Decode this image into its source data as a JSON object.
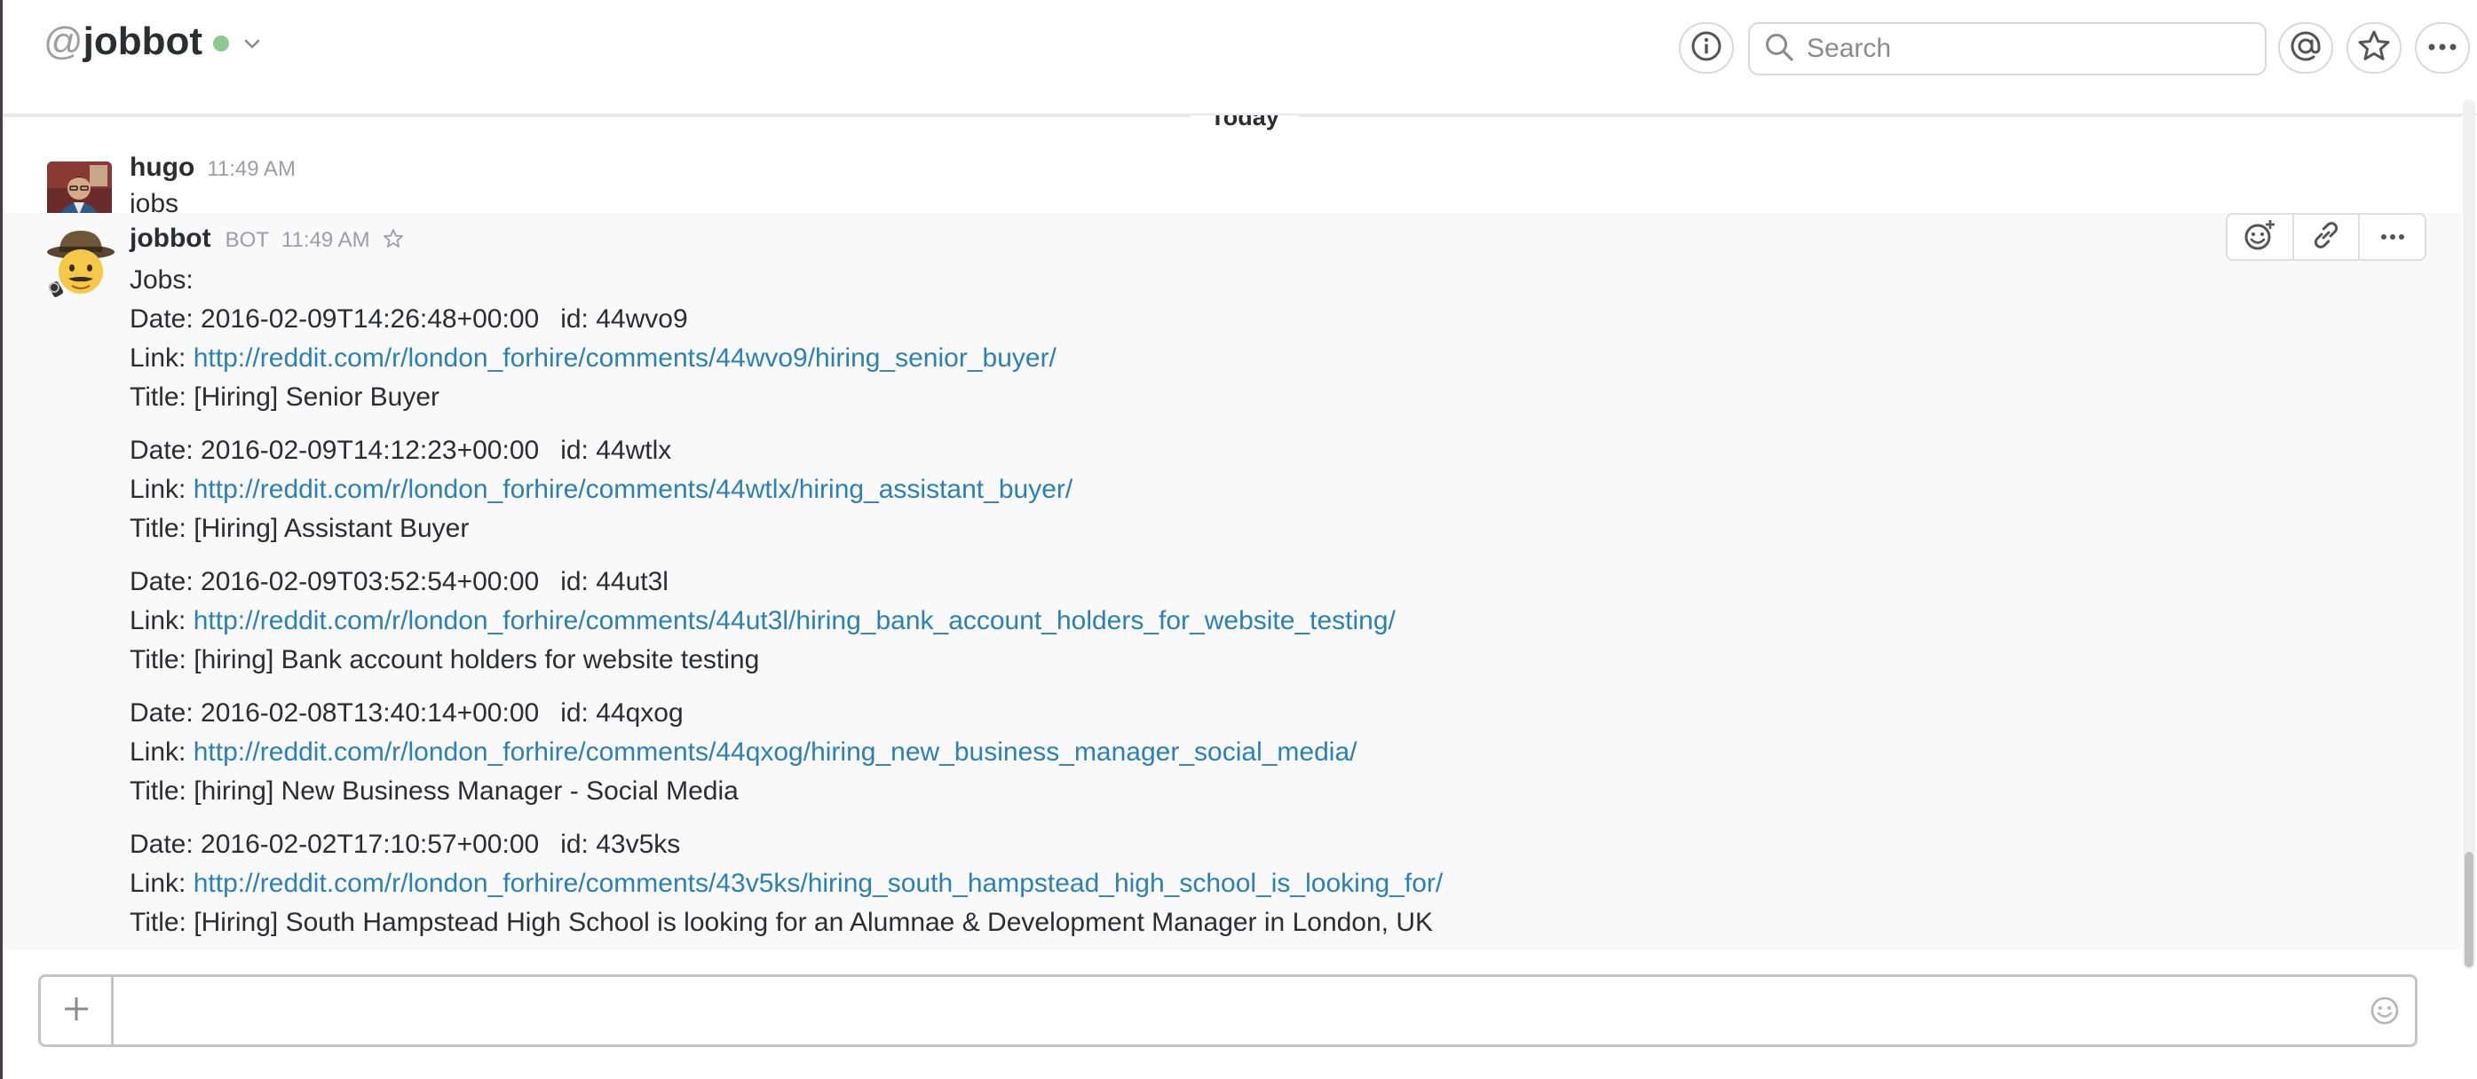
{
  "header": {
    "at_sign": "@",
    "channel_name": "jobbot",
    "search_placeholder": "Search"
  },
  "divider": {
    "label": "Today"
  },
  "messages": [
    {
      "author": "hugo",
      "time": "11:49 AM",
      "text": "jobs"
    },
    {
      "author": "jobbot",
      "bot_tag": "BOT",
      "time": "11:49 AM",
      "intro": "Jobs:",
      "jobs": [
        {
          "date_line": "Date: 2016-02-09T14:26:48+00:00",
          "id_line": "id: 44wvo9",
          "link_prefix": "Link: ",
          "url": "http://reddit.com/r/london_forhire/comments/44wvo9/hiring_senior_buyer/",
          "title_line": "Title: [Hiring] Senior Buyer"
        },
        {
          "date_line": "Date: 2016-02-09T14:12:23+00:00",
          "id_line": "id: 44wtlx",
          "link_prefix": "Link: ",
          "url": "http://reddit.com/r/london_forhire/comments/44wtlx/hiring_assistant_buyer/",
          "title_line": "Title: [Hiring] Assistant Buyer"
        },
        {
          "date_line": "Date: 2016-02-09T03:52:54+00:00",
          "id_line": "id: 44ut3l",
          "link_prefix": "Link: ",
          "url": "http://reddit.com/r/london_forhire/comments/44ut3l/hiring_bank_account_holders_for_website_testing/",
          "title_line": "Title: [hiring] Bank account holders for website testing"
        },
        {
          "date_line": "Date: 2016-02-08T13:40:14+00:00",
          "id_line": "id: 44qxog",
          "link_prefix": "Link: ",
          "url": "http://reddit.com/r/london_forhire/comments/44qxog/hiring_new_business_manager_social_media/",
          "title_line": "Title: [hiring] New Business Manager - Social Media"
        },
        {
          "date_line": "Date: 2016-02-02T17:10:57+00:00",
          "id_line": "id: 43v5ks",
          "link_prefix": "Link: ",
          "url": "http://reddit.com/r/london_forhire/comments/43v5ks/hiring_south_hampstead_high_school_is_looking_for/",
          "title_line": "Title: [Hiring] South Hampstead High School is looking for an Alumnae & Development Manager in London, UK"
        }
      ]
    }
  ],
  "composer": {
    "value": ""
  },
  "colors": {
    "link": "#2a80b9",
    "presence": "#8fc98f",
    "sidebar_edge": "#4d394b"
  },
  "icons": [
    "chevron-down-icon",
    "info-icon",
    "search-icon",
    "mention-icon",
    "star-icon",
    "more-icon",
    "add-reaction-icon",
    "link-icon",
    "plus-icon",
    "emoji-icon"
  ]
}
